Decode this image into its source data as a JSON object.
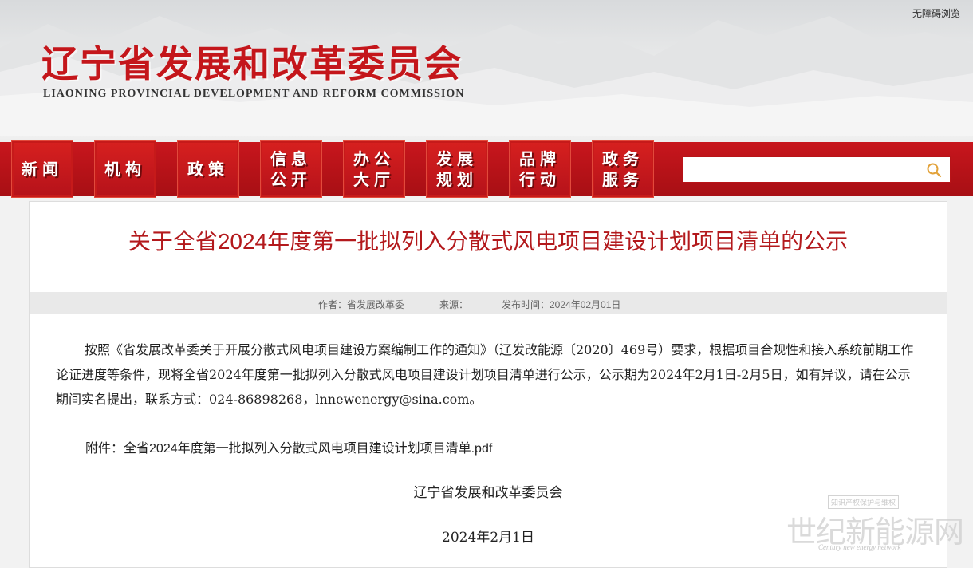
{
  "header": {
    "accessibility_label": "无障碍浏览",
    "logo_cn": "辽宁省发展和改革委员会",
    "logo_en": "LIAONING PROVINCIAL DEVELOPMENT AND REFORM COMMISSION"
  },
  "nav": {
    "items": [
      {
        "label": "新闻"
      },
      {
        "label": "机构"
      },
      {
        "label": "政策"
      },
      {
        "label": "信息\n公开"
      },
      {
        "label": "办公\n大厅"
      },
      {
        "label": "发展\n规划"
      },
      {
        "label": "品牌\n行动"
      },
      {
        "label": "政务\n服务"
      }
    ],
    "search_placeholder": ""
  },
  "article": {
    "title": "关于全省2024年度第一批拟列入分散式风电项目建设计划项目清单的公示",
    "meta": {
      "author": "作者：省发展改革委",
      "source": "来源：",
      "published": "发布时间：2024年02月01日"
    },
    "body": "按照《省发展改革委关于开展分散式风电项目建设方案编制工作的通知》（辽发改能源〔2020〕469号）要求，根据项目合规性和接入系统前期工作论证进度等条件，现将全省2024年度第一批拟列入分散式风电项目建设计划项目清单进行公示，公示期为2024年2月1日-2月5日，如有异议，请在公示期间实名提出，联系方式：024-86898268，lnnewenergy@sina.com。",
    "attachment_label": "附件：",
    "attachment_link": "全省2024年度第一批拟列入分散式风电项目建设计划项目清单.pdf",
    "signature": "辽宁省发展和改革委员会",
    "date": "2024年2月1日"
  },
  "watermark": {
    "small": "知识产权保护与维权",
    "big": "世纪新能源网",
    "en": "Century new energy network"
  },
  "colors": {
    "brand_red": "#c4161b",
    "nav_red": "#c8161d",
    "title_red": "#b3191c",
    "meta_bg": "#e9e9e9",
    "search_icon": "#e2a23a"
  }
}
